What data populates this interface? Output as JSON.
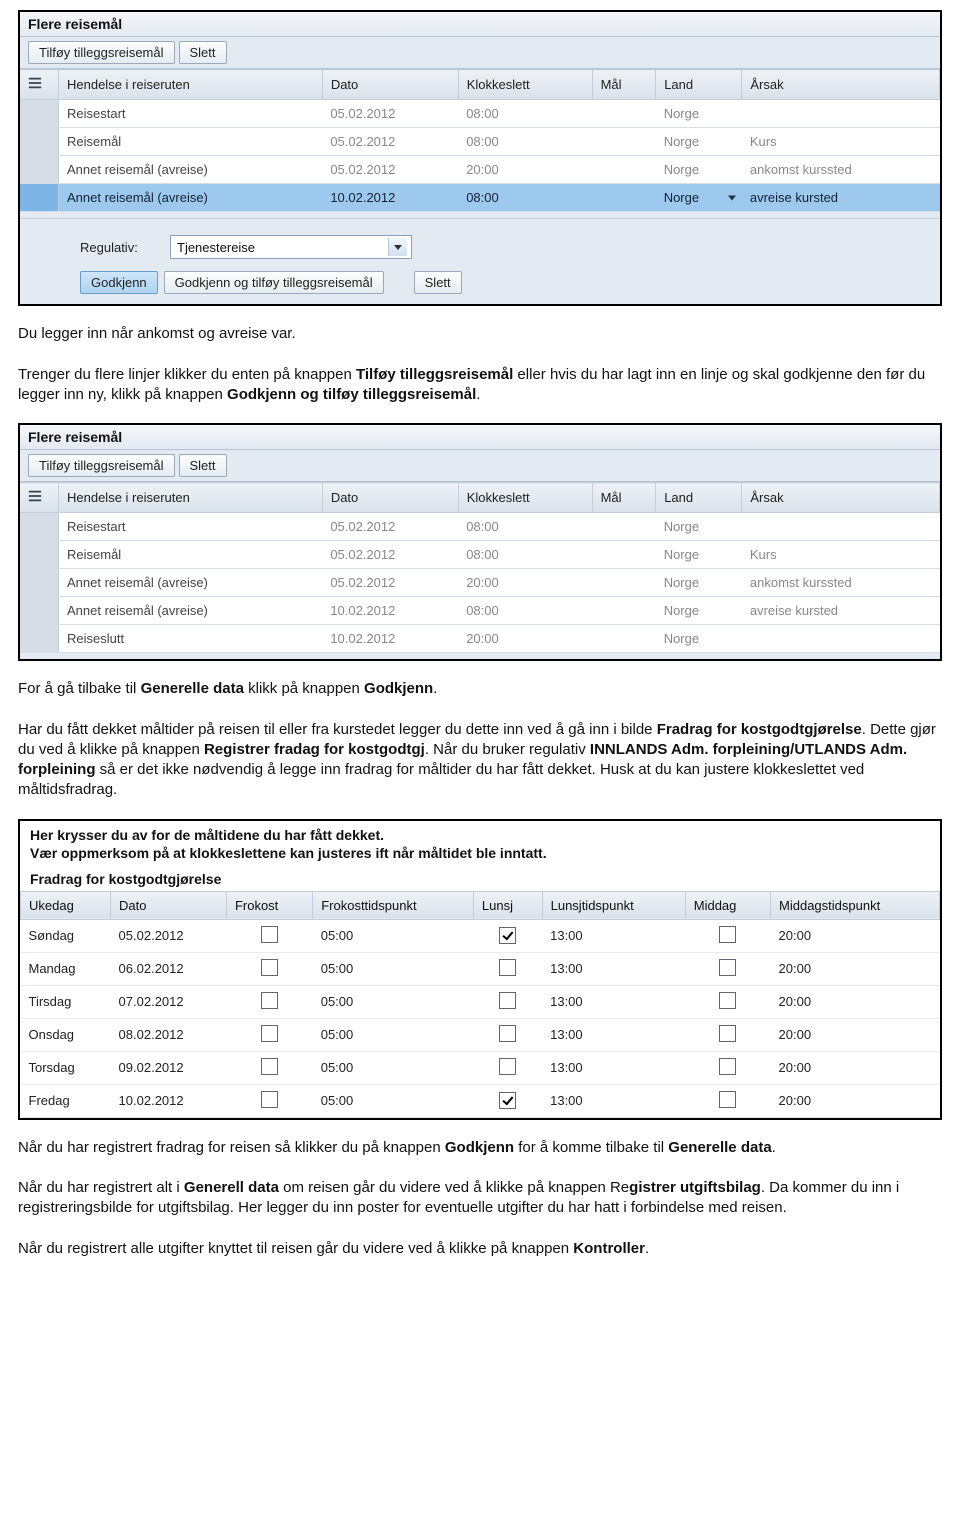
{
  "panel1": {
    "title": "Flere reisemål",
    "tb_add": "Tilføy tilleggsreisemål",
    "tb_del": "Slett",
    "cols": {
      "c0": "",
      "c1": "Hendelse i reiseruten",
      "c2": "Dato",
      "c3": "Klokkeslett",
      "c4": "Mål",
      "c5": "Land",
      "c6": "Årsak"
    },
    "rows": [
      {
        "h": "Reisestart",
        "d": "05.02.2012",
        "k": "08:00",
        "m": "",
        "l": "Norge",
        "a": ""
      },
      {
        "h": "Reisemål",
        "d": "05.02.2012",
        "k": "08:00",
        "m": "",
        "l": "Norge",
        "a": "Kurs"
      },
      {
        "h": "Annet reisemål (avreise)",
        "d": "05.02.2012",
        "k": "20:00",
        "m": "",
        "l": "Norge",
        "a": "ankomst kurssted"
      },
      {
        "h": "Annet reisemål (avreise)",
        "d": "10.02.2012",
        "k": "08:00",
        "m": "",
        "l": "Norge",
        "a": "avreise kursted"
      }
    ],
    "reg_label": "Regulativ:",
    "reg_value": "Tjenestereise",
    "btn_g": "Godkjenn",
    "btn_gt": "Godkjenn og tilføy tilleggsreisemål",
    "btn_s": "Slett"
  },
  "para1": "Du legger inn når ankomst og avreise var.",
  "para2a": "Trenger du flere linjer klikker du enten på knappen ",
  "para2b": "Tilføy tilleggsreisemål",
  "para2c": " eller hvis du har lagt inn en linje og skal godkjenne den før du legger inn ny, klikk på knappen ",
  "para2d": "Godkjenn og tilføy tilleggsreisemål",
  "para2e": ".",
  "panel2": {
    "title": "Flere reisemål",
    "tb_add": "Tilføy tilleggsreisemål",
    "tb_del": "Slett",
    "cols": {
      "c0": "",
      "c1": "Hendelse i reiseruten",
      "c2": "Dato",
      "c3": "Klokkeslett",
      "c4": "Mål",
      "c5": "Land",
      "c6": "Årsak"
    },
    "rows": [
      {
        "h": "Reisestart",
        "d": "05.02.2012",
        "k": "08:00",
        "m": "",
        "l": "Norge",
        "a": ""
      },
      {
        "h": "Reisemål",
        "d": "05.02.2012",
        "k": "08:00",
        "m": "",
        "l": "Norge",
        "a": "Kurs"
      },
      {
        "h": "Annet reisemål (avreise)",
        "d": "05.02.2012",
        "k": "20:00",
        "m": "",
        "l": "Norge",
        "a": "ankomst kurssted"
      },
      {
        "h": "Annet reisemål (avreise)",
        "d": "10.02.2012",
        "k": "08:00",
        "m": "",
        "l": "Norge",
        "a": "avreise kursted"
      },
      {
        "h": "Reiseslutt",
        "d": "10.02.2012",
        "k": "20:00",
        "m": "",
        "l": "Norge",
        "a": ""
      }
    ]
  },
  "para3a": "For å gå tilbake til ",
  "para3b": "Generelle data",
  "para3c": " klikk på knappen ",
  "para3d": "Godkjenn",
  "para3e": ".",
  "para4a": "Har du fått dekket måltider på reisen til eller fra kurstedet legger du dette inn ved å gå inn i bilde ",
  "para4b": "Fradrag for kostgodtgjørelse",
  "para4c": ". Dette gjør du ved å klikke på knappen ",
  "para4d": "Registrer fradag for kostgodtgj",
  "para4e": ". Når du bruker regulativ ",
  "para4f": "INNLANDS Adm. forpleining/UTLANDS Adm. forpleining",
  "para4g": " så er det ikke nødvendig å legge inn fradrag for måltider du har fått dekket. Husk at du kan justere klokkeslettet ved måltidsfradrag.",
  "panel3": {
    "line1": "Her krysser du av for de måltidene du har fått dekket.",
    "line2": "Vær oppmerksom på at klokkeslettene kan justeres ift når måltidet ble inntatt.",
    "subtitle": "Fradrag for kostgodtgjørelse",
    "cols": {
      "c1": "Ukedag",
      "c2": "Dato",
      "c3": "Frokost",
      "c4": "Frokosttidspunkt",
      "c5": "Lunsj",
      "c6": "Lunsjtidspunkt",
      "c7": "Middag",
      "c8": "Middagstidspunkt"
    },
    "rows": [
      {
        "u": "Søndag",
        "d": "05.02.2012",
        "f": false,
        "ft": "05:00",
        "l": true,
        "lt": "13:00",
        "m": false,
        "mt": "20:00"
      },
      {
        "u": "Mandag",
        "d": "06.02.2012",
        "f": false,
        "ft": "05:00",
        "l": false,
        "lt": "13:00",
        "m": false,
        "mt": "20:00"
      },
      {
        "u": "Tirsdag",
        "d": "07.02.2012",
        "f": false,
        "ft": "05:00",
        "l": false,
        "lt": "13:00",
        "m": false,
        "mt": "20:00"
      },
      {
        "u": "Onsdag",
        "d": "08.02.2012",
        "f": false,
        "ft": "05:00",
        "l": false,
        "lt": "13:00",
        "m": false,
        "mt": "20:00"
      },
      {
        "u": "Torsdag",
        "d": "09.02.2012",
        "f": false,
        "ft": "05:00",
        "l": false,
        "lt": "13:00",
        "m": false,
        "mt": "20:00"
      },
      {
        "u": "Fredag",
        "d": "10.02.2012",
        "f": false,
        "ft": "05:00",
        "l": true,
        "lt": "13:00",
        "m": false,
        "mt": "20:00"
      }
    ]
  },
  "para5a": "Når du har registrert fradrag for reisen så klikker du på knappen ",
  "para5b": "Godkjenn",
  "para5c": " for å komme tilbake til ",
  "para5d": "Generelle data",
  "para5e": ".",
  "para6a": "Når du har registrert alt i ",
  "para6b": "Generell data",
  "para6c": " om reisen går du videre ved å klikke på knappen Re",
  "para6d": "gistrer utgiftsbilag",
  "para6e": ". Da kommer du inn i registreringsbilde for utgiftsbilag. Her legger du inn poster for eventuelle utgifter du har hatt i forbindelse med reisen.",
  "para7a": "Når du registrert alle utgifter knyttet til reisen går du videre ved å klikke på knappen ",
  "para7b": "Kontroller",
  "para7c": "."
}
